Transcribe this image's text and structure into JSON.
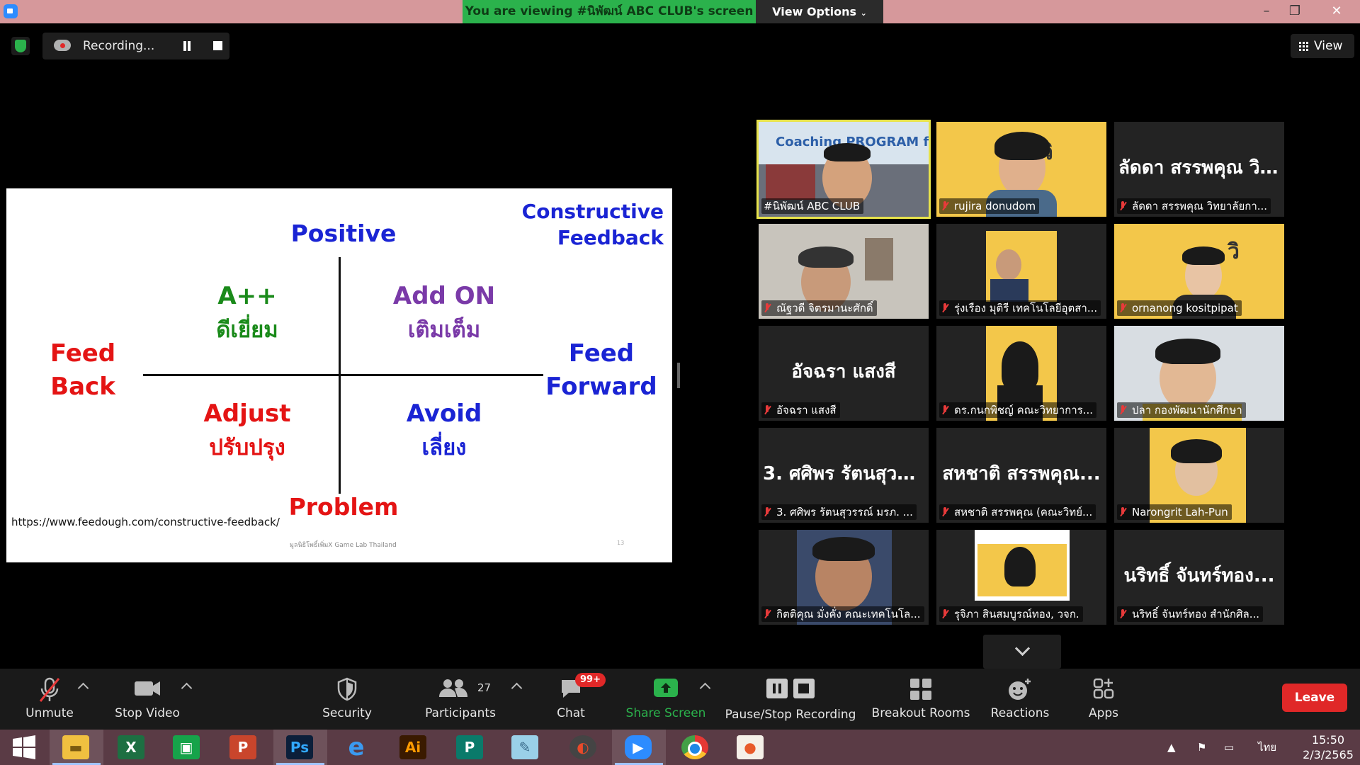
{
  "titlebar": {
    "viewing_banner": "You are viewing #นิพัฒน์ ABC CLUB's screen",
    "view_options": "View Options",
    "minimize": "–",
    "restore": "❐",
    "close": "✕"
  },
  "top_strip": {
    "recording_label": "Recording...",
    "view_label": "View"
  },
  "slide": {
    "positive": "Positive",
    "problem": "Problem",
    "constructive": "Constructive",
    "feedback_word": "Feedback",
    "feed_back_1": "Feed",
    "feed_back_2": "Back",
    "feed_forward_1": "Feed",
    "feed_forward_2": "Forward",
    "q1_title": "A++",
    "q1_sub": "ดีเยี่ยม",
    "q2_title": "Add ON",
    "q2_sub": "เติมเต็ม",
    "q3_title": "Adjust",
    "q3_sub": "ปรับปรุง",
    "q4_title": "Avoid",
    "q4_sub": "เลี่ยง",
    "url": "https://www.feedough.com/constructive-feedback/",
    "footer": "มูลนิธิโพธิ์เพิ่มX Game Lab Thailand",
    "page_number": "13",
    "colors": {
      "blue": "#1a24d4",
      "green": "#1a8a1a",
      "purple": "#7a3aa8",
      "red": "#e41414"
    }
  },
  "gallery": {
    "tiles": [
      {
        "caption": "#นิพัฒน์ ABC CLUB",
        "muted": false,
        "big_name": ""
      },
      {
        "caption": "rujira donudom",
        "muted": true,
        "big_name": ""
      },
      {
        "caption": "ลัดดา สรรพคุณ วิทยาลัยกา...",
        "muted": true,
        "big_name": "ลัดดา สรรพคุณ วิ..."
      },
      {
        "caption": "ณัฐวดี จิตรมานะศักดิ์",
        "muted": true,
        "big_name": ""
      },
      {
        "caption": "รุ่งเรือง มุติรี เทคโนโลยีอุตสา...",
        "muted": true,
        "big_name": ""
      },
      {
        "caption": "ornanong kositpipat",
        "muted": true,
        "big_name": ""
      },
      {
        "caption": "อัจฉรา แสงสี",
        "muted": true,
        "big_name": "อัจฉรา แสงสี"
      },
      {
        "caption": "ดร.กนกพิชญ์ คณะวิทยาการ...",
        "muted": true,
        "big_name": ""
      },
      {
        "caption": "ปลา กองพัฒนานักศึกษา",
        "muted": true,
        "big_name": ""
      },
      {
        "caption": "3. ศศิพร รัตนสุวรรณ์ มรภ. ...",
        "muted": true,
        "big_name": "3. ศศิพร รัตนสุวร..."
      },
      {
        "caption": "สหชาติ สรรพคุณ (คณะวิทย์...",
        "muted": true,
        "big_name": "สหชาติ สรรพคุณ..."
      },
      {
        "caption": "Narongrit Lah-Pun",
        "muted": true,
        "big_name": ""
      },
      {
        "caption": "กิตติคุณ มั่งคั่ง คณะเทคโนโล...",
        "muted": true,
        "big_name": ""
      },
      {
        "caption": "รุจิภา สินสมบูรณ์ทอง, วจก.",
        "muted": true,
        "big_name": ""
      },
      {
        "caption": "นริทธิ์ จันทร์ทอง สำนักศิล...",
        "muted": true,
        "big_name": "นริทธิ์ จันทร์ทอง..."
      }
    ],
    "poster_text": "Coaching PROGRAM for"
  },
  "toolbar": {
    "unmute": "Unmute",
    "stop_video": "Stop Video",
    "security": "Security",
    "participants": "Participants",
    "participants_count": "27",
    "chat": "Chat",
    "chat_badge": "99+",
    "share_screen": "Share Screen",
    "pause_stop_recording": "Pause/Stop Recording",
    "breakout_rooms": "Breakout Rooms",
    "reactions": "Reactions",
    "apps": "Apps",
    "leave": "Leave"
  },
  "taskbar": {
    "apps": [
      "start",
      "file-explorer",
      "excel",
      "store",
      "powerpoint",
      "photoshop",
      "internet-explorer",
      "illustrator",
      "publisher",
      "notepad",
      "photoscape",
      "zoom",
      "chrome",
      "paint"
    ],
    "language": "ไทย",
    "time": "15:50",
    "date": "2/3/2565"
  }
}
